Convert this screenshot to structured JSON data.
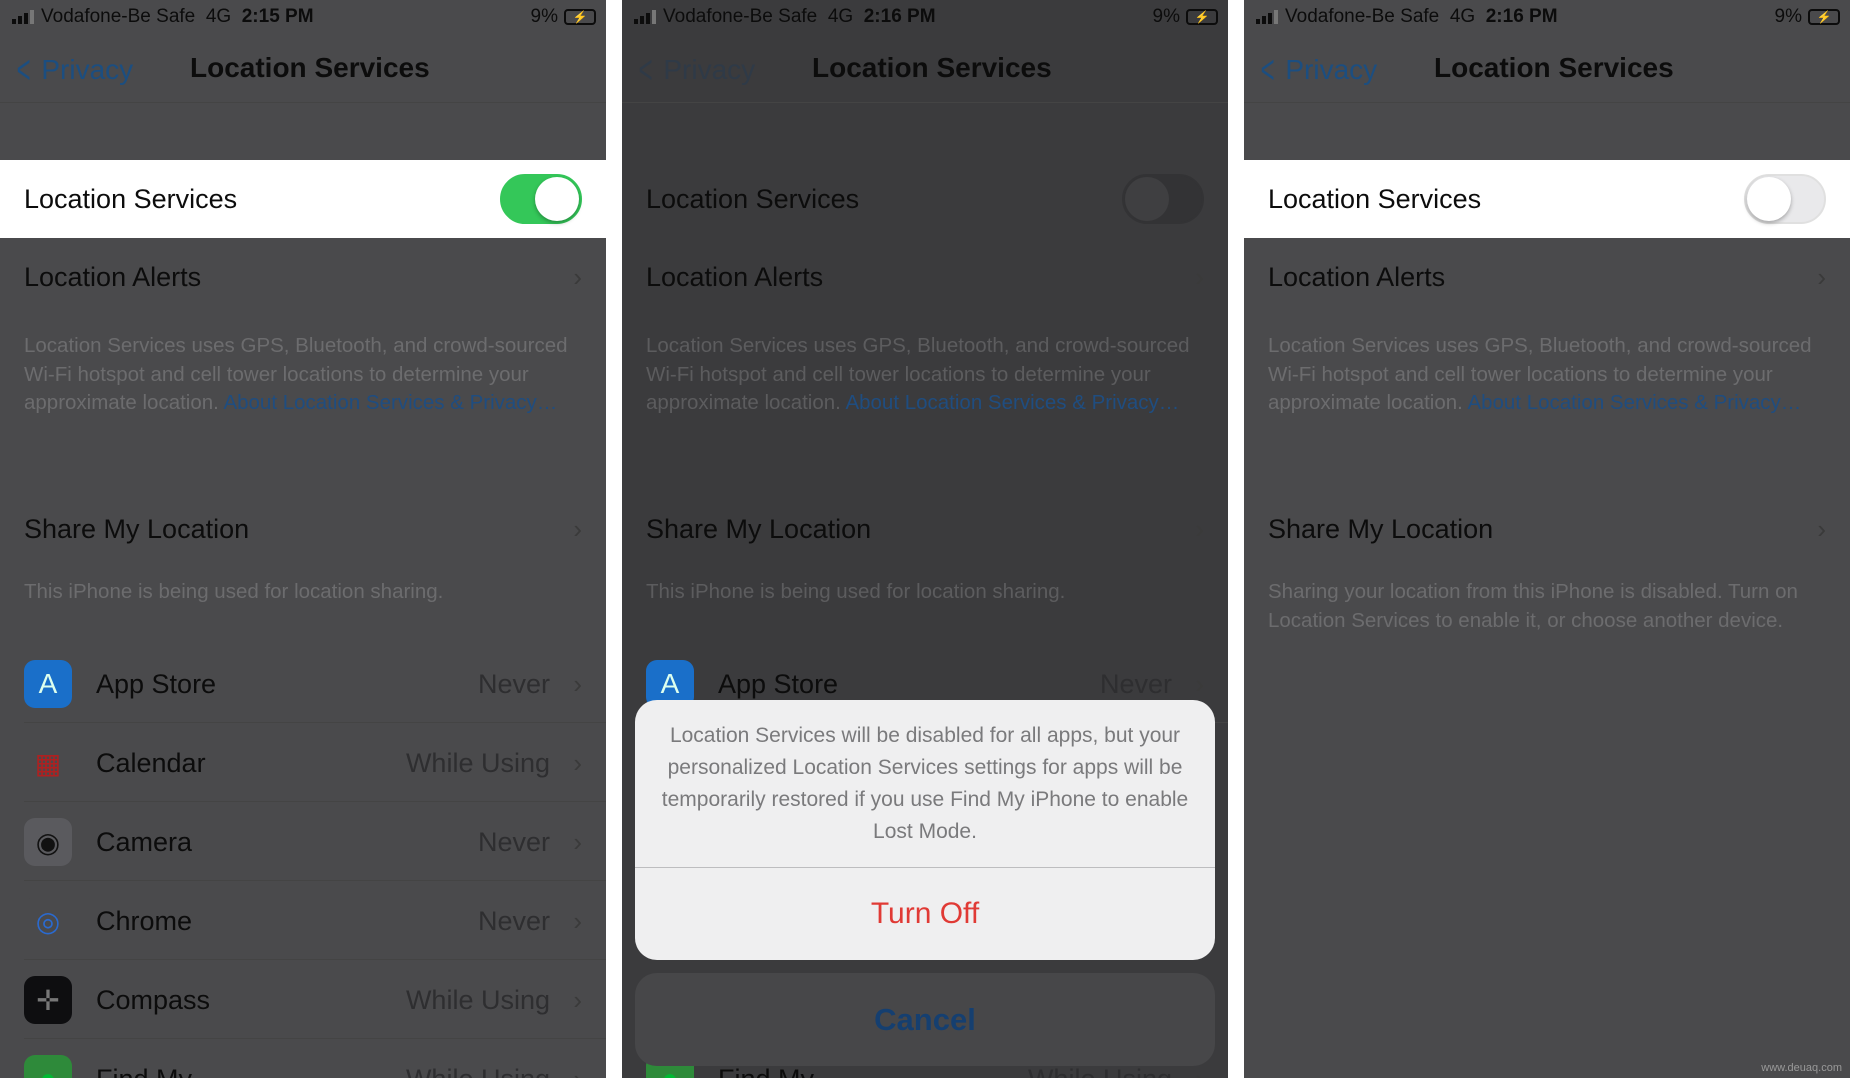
{
  "panels": [
    {
      "status": {
        "carrier": "Vodafone-Be Safe",
        "network": "4G",
        "time": "2:15 PM",
        "battery": "9%"
      },
      "nav": {
        "back": "Privacy",
        "title": "Location Services"
      },
      "location_services": {
        "label": "Location Services",
        "on": true
      },
      "alerts": {
        "label": "Location Alerts"
      },
      "footer": {
        "text": "Location Services uses GPS, Bluetooth, and crowd-sourced Wi-Fi hotspot and cell tower locations to determine your approximate location.",
        "link": "About Location Services & Privacy…"
      },
      "share": {
        "label": "Share My Location",
        "footer": "This iPhone is being used for location sharing."
      },
      "apps": [
        {
          "name": "App Store",
          "value": "Never",
          "icon": "app-store-icon"
        },
        {
          "name": "Calendar",
          "value": "While Using",
          "icon": "calendar-icon"
        },
        {
          "name": "Camera",
          "value": "Never",
          "icon": "camera-icon"
        },
        {
          "name": "Chrome",
          "value": "Never",
          "icon": "chrome-icon"
        },
        {
          "name": "Compass",
          "value": "While Using",
          "icon": "compass-icon"
        },
        {
          "name": "Find My",
          "value": "While Using",
          "icon": "find-my-icon"
        }
      ]
    },
    {
      "status": {
        "carrier": "Vodafone-Be Safe",
        "network": "4G",
        "time": "2:16 PM",
        "battery": "9%"
      },
      "nav": {
        "back": "Privacy",
        "title": "Location Services"
      },
      "location_services": {
        "label": "Location Services",
        "on": false
      },
      "alerts": {
        "label": "Location Alerts"
      },
      "footer": {
        "text": "Location Services uses GPS, Bluetooth, and crowd-sourced Wi-Fi hotspot and cell tower locations to determine your approximate location.",
        "link": "About Location Services & Privacy…"
      },
      "share": {
        "label": "Share My Location",
        "footer": "This iPhone is being used for location sharing."
      },
      "apps": [
        {
          "name": "App Store",
          "value": "Never",
          "icon": "app-store-icon"
        },
        {
          "name": "Find My",
          "value": "While Using",
          "icon": "find-my-icon"
        }
      ],
      "action_sheet": {
        "message": "Location Services will be disabled for all apps, but your personalized Location Services settings for apps will be temporarily restored if you use Find My iPhone to enable Lost Mode.",
        "destructive": "Turn Off",
        "cancel": "Cancel"
      }
    },
    {
      "status": {
        "carrier": "Vodafone-Be Safe",
        "network": "4G",
        "time": "2:16 PM",
        "battery": "9%"
      },
      "nav": {
        "back": "Privacy",
        "title": "Location Services"
      },
      "location_services": {
        "label": "Location Services",
        "on": false
      },
      "alerts": {
        "label": "Location Alerts"
      },
      "footer": {
        "text": "Location Services uses GPS, Bluetooth, and crowd-sourced Wi-Fi hotspot and cell tower locations to determine your approximate location.",
        "link": "About Location Services & Privacy…"
      },
      "share": {
        "label": "Share My Location",
        "footer": "Sharing your location from this iPhone is disabled. Turn on Location Services to enable it, or choose another device."
      },
      "apps": []
    }
  ],
  "watermark": "www.deuaq.com",
  "colors": {
    "toggle_on": "#34c759",
    "link": "#1f4d80",
    "destructive": "#e03a35",
    "cancel": "#153f70"
  }
}
